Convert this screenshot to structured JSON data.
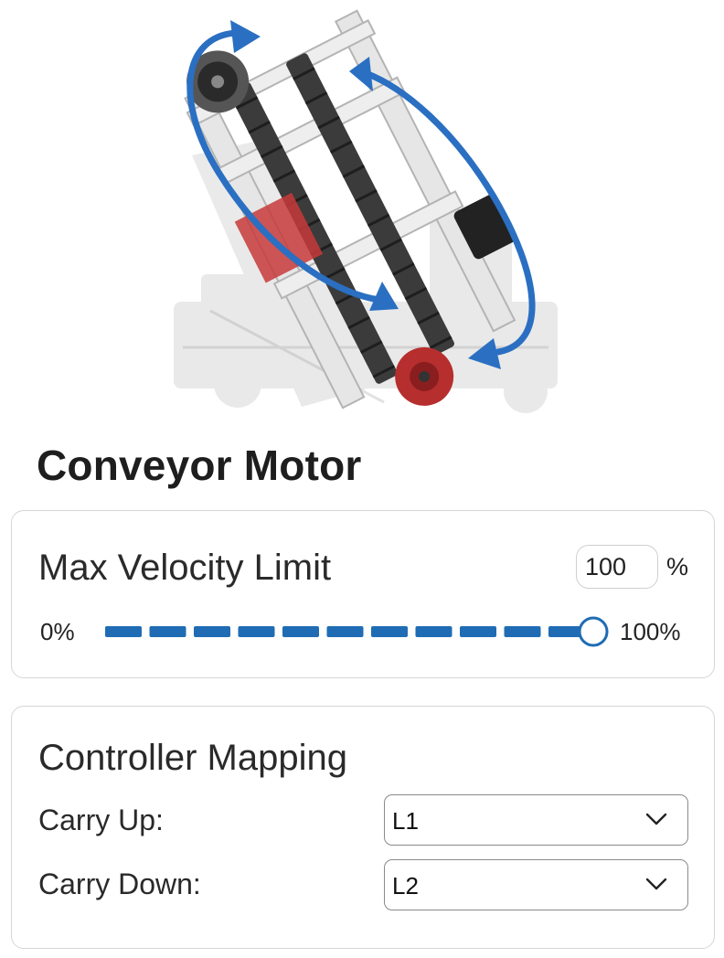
{
  "page": {
    "title": "Conveyor Motor"
  },
  "hero": {
    "icon": "robot-conveyor-illustration",
    "arrow_color": "#2a6fc2",
    "accent_red": "#c73a3a"
  },
  "velocity": {
    "label": "Max Velocity Limit",
    "value": "100",
    "unit": "%",
    "range_min_label": "0%",
    "range_max_label": "100%",
    "slider_fraction": 1.0,
    "track_color": "#1f6cb4"
  },
  "mapping": {
    "label": "Controller Mapping",
    "rows": [
      {
        "label": "Carry Up:",
        "selected": "L1",
        "icon": "chevron-down-icon"
      },
      {
        "label": "Carry Down:",
        "selected": "L2",
        "icon": "chevron-down-icon"
      }
    ]
  }
}
